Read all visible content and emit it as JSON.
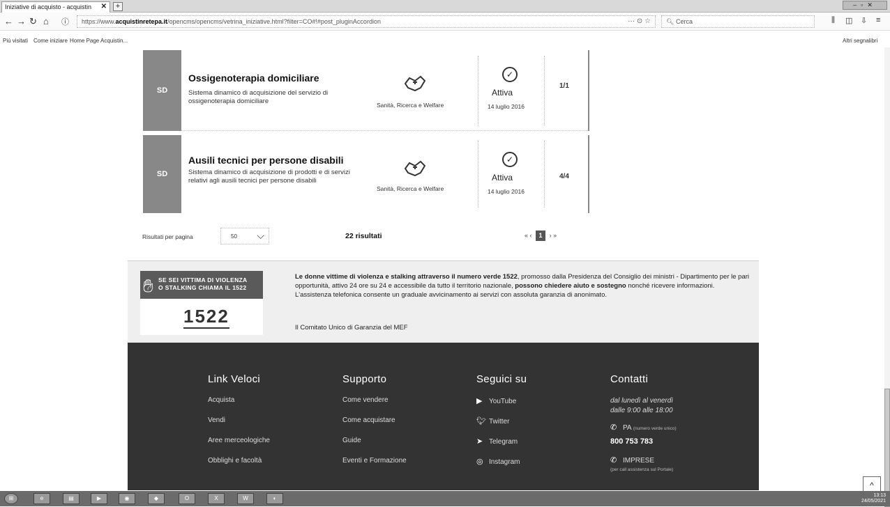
{
  "browser": {
    "tab_title": "Iniziative di acquisto - acquistin",
    "tab_close": "✕",
    "new_tab": "+",
    "url_prefix": "https://www.",
    "url_domain": "acquistinretepa.it",
    "url_rest": "/opencms/opencms/vetrina_iniziative.html?filter=CO#!#post_pluginAccordion",
    "search_placeholder": "Cerca",
    "bookmarks": [
      "Più visitati",
      "Come iniziare",
      "Home Page Acquistin..."
    ],
    "other_bookmarks": "Altri segnalibri",
    "url_more": "··· ⊙ ☆"
  },
  "listings": [
    {
      "badge": "SD",
      "title": "Ossigenoterapia domiciliare",
      "description": "Sistema dinamico di acquisizione del servizio di ossigenoterapia domiciliare",
      "category": "Sanità, Ricerca e Welfare",
      "status": "Attiva",
      "date": "14 luglio 2016",
      "count": "1/1"
    },
    {
      "badge": "SD",
      "title": "Ausili tecnici per persone disabili",
      "description": "Sistema dinamico di acquisizione di prodotti e di servizi relativi agli ausili tecnici per persone disabili",
      "category": "Sanità, Ricerca e Welfare",
      "status": "Attiva",
      "date": "14 luglio 2016",
      "count": "4/4"
    }
  ],
  "pager": {
    "per_page_label": "Risultati per pagina",
    "per_page_value": "50",
    "results": "22 risultati",
    "first": "«",
    "prev": "‹",
    "current": "1",
    "next": "›",
    "last": "»"
  },
  "banner": {
    "logo_line1": "SE SEI VITTIMA DI VIOLENZA",
    "logo_line2": "O STALKING CHIAMA IL 1522",
    "logo_number": "1522",
    "text_bold1": "Le donne vittime di violenza e stalking attraverso il numero verde 1522",
    "text_plain1": ", promosso dalla Presidenza del Consiglio dei ministri - Dipartimento per le pari opportunità, attivo 24 ore su 24 e accessibile da tutto il territorio nazionale, ",
    "text_bold2": "possono chiedere aiuto e sostegno",
    "text_plain2": " nonché ricevere informazioni. L'assistenza telefonica consente un graduale avvicinamento ai servizi con assoluta garanzia di anonimato.",
    "signature": "Il Comitato Unico di Garanzia del MEF"
  },
  "footer": {
    "link_veloci": {
      "title": "Link Veloci",
      "items": [
        "Acquista",
        "Vendi",
        "Aree merceologiche",
        "Obblighi e facoltà"
      ]
    },
    "supporto": {
      "title": "Supporto",
      "items": [
        "Come vendere",
        "Come acquistare",
        "Guide",
        "Eventi e Formazione"
      ]
    },
    "seguici": {
      "title": "Seguici su",
      "items": [
        {
          "icon": "youtube-icon",
          "label": "YouTube"
        },
        {
          "icon": "twitter-icon",
          "label": "Twitter"
        },
        {
          "icon": "telegram-icon",
          "label": "Telegram"
        },
        {
          "icon": "instagram-icon",
          "label": "Instagram"
        }
      ]
    },
    "contatti": {
      "title": "Contatti",
      "hours_line1": "dal lunedì al venerdì",
      "hours_line2": "dalle 9:00 alle 18:00",
      "pa_label": "PA",
      "pa_sub": "(numero verde unico)",
      "pa_phone": "800 753 783",
      "imprese_label": "IMPRESE",
      "imprese_sub": "(per call assistenza sul Portale)"
    }
  },
  "scroll_top": "^",
  "tray": {
    "time": "13:13",
    "date": "24/05/2021"
  },
  "colors": {
    "badge_gray": "#888888",
    "footer_bg": "#333333",
    "banner_bg": "#efefef"
  }
}
